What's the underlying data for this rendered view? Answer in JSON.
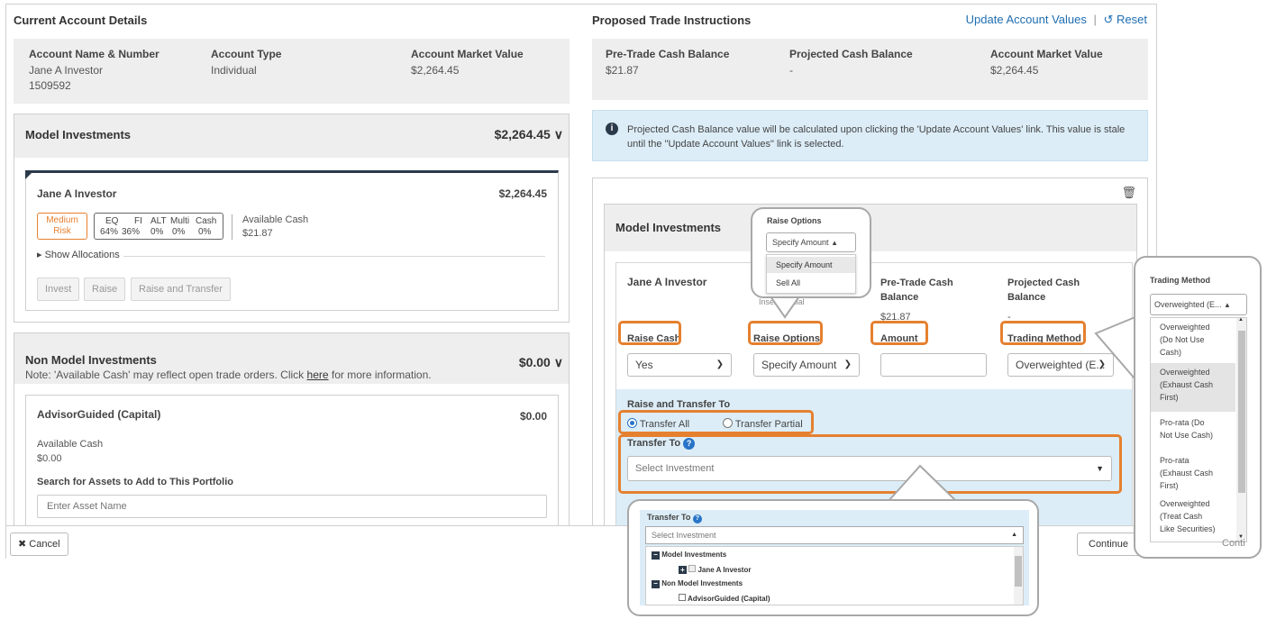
{
  "current": {
    "title": "Current Account Details",
    "cols": [
      {
        "label": "Account Name & Number",
        "value": "Jane A Investor",
        "value2": "1509592"
      },
      {
        "label": "Account Type",
        "value": "Individual"
      },
      {
        "label": "Account Market Value",
        "value": "$2,264.45"
      }
    ],
    "model": {
      "title": "Model Investments",
      "amount": "$2,264.45",
      "card": {
        "name": "Jane A Investor",
        "amount": "$2,264.45",
        "risk_line1": "Medium",
        "risk_line2": "Risk",
        "alloc_headers": [
          "EQ",
          "FI",
          "ALT",
          "Multi",
          "Cash"
        ],
        "alloc_values": [
          "64%",
          "36%",
          "0%",
          "0%",
          "0%"
        ],
        "avail_label": "Available Cash",
        "avail_value": "$21.87",
        "show_alloc": "Show Allocations",
        "buttons": [
          "Invest",
          "Raise",
          "Raise and Transfer"
        ]
      }
    },
    "nonmodel": {
      "title": "Non Model Investments",
      "amount": "$0.00",
      "note_pre": "Note: 'Available Cash' may reflect open trade orders. Click ",
      "note_link": "here",
      "note_post": " for more information.",
      "card": {
        "name": "AdvisorGuided (Capital)",
        "amount": "$0.00",
        "avail_label": "Available Cash",
        "avail_value": "$0.00",
        "search_label": "Search for Assets to Add to This Portfolio",
        "search_placeholder": "Enter Asset Name"
      }
    }
  },
  "proposed": {
    "title": "Proposed Trade Instructions",
    "update_link": "Update Account Values",
    "reset_link": "Reset",
    "cols": [
      {
        "label": "Pre-Trade Cash Balance",
        "value": "$21.87"
      },
      {
        "label": "Projected Cash Balance",
        "value": "-"
      },
      {
        "label": "Account Market Value",
        "value": "$2,264.45"
      }
    ],
    "info": "Projected Cash Balance value will be calculated upon clicking the 'Update Account Values' link. This value is stale until the \"Update Account Values\" link is selected.",
    "model": {
      "title": "Model Investments",
      "name": "Jane A Investor",
      "hidden_text": "Insert Partial",
      "pre_label_1": "Pre-Trade Cash",
      "pre_label_2": "Balance",
      "pre_value": "$21.87",
      "proj_label_1": "Projected Cash",
      "proj_label_2": "Balance",
      "proj_value": "-",
      "raise_cash_label": "Raise Cash",
      "raise_cash_value": "Yes",
      "raise_options_label": "Raise Options",
      "raise_options_value": "Specify Amount",
      "amount_label": "Amount",
      "trading_label": "Trading Method",
      "trading_value": "Overweighted (E...",
      "rt_title": "Raise and Transfer To",
      "radio_all": "Transfer All",
      "radio_partial": "Transfer Partial",
      "transfer_label": "Transfer To",
      "transfer_placeholder": "Select Investment"
    }
  },
  "footer": {
    "cancel": "Cancel",
    "continue": "Continue",
    "cut_text": "Conti"
  },
  "callout_raise": {
    "label": "Raise Options",
    "value": "Specify Amount",
    "options": [
      "Specify Amount",
      "Sell All"
    ]
  },
  "callout_trading": {
    "label": "Trading Method",
    "value": "Overweighted (E...",
    "options": [
      [
        "Overweighted",
        "(Do Not Use",
        "Cash)"
      ],
      [
        "Overweighted",
        "(Exhaust Cash",
        "First)"
      ],
      [
        "Pro-rata (Do",
        "Not Use Cash)"
      ],
      [
        "Pro-rata",
        "(Exhaust Cash",
        "First)"
      ],
      [
        "Overweighted",
        "(Treat Cash",
        "Like Securities)"
      ]
    ]
  },
  "callout_transfer": {
    "label": "Transfer To",
    "placeholder": "Select Investment",
    "group1": "Model Investments",
    "item1": "Jane A Investor",
    "group2": "Non Model Investments",
    "item2": "AdvisorGuided (Capital)"
  },
  "colors": {
    "accent": "#e5802f",
    "link": "#1f6eb2",
    "info_bg": "#dcedf7",
    "panel": "#eeeeee"
  }
}
